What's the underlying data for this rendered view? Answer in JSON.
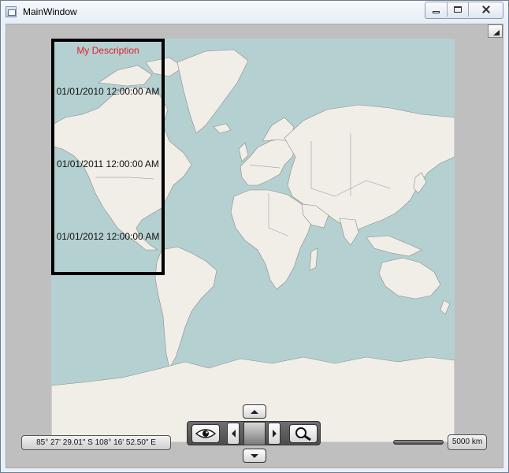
{
  "window": {
    "title": "MainWindow",
    "controls": [
      "minimize",
      "maximize",
      "close"
    ]
  },
  "map": {
    "description_title": "My Description",
    "dates": [
      "01/01/2010 12:00:00 AM",
      "01/01/2011 12:00:00 AM",
      "01/01/2012 12:00:00 AM"
    ],
    "coordinates": "85° 27' 29.01\" S 108° 16' 52.50\" E",
    "scale": "5000 km",
    "colors": {
      "water": "#b5d0d0",
      "land": "#f1eee8",
      "border": "#8c8c8c",
      "description_border": "#000000",
      "description_title": "#e0202a"
    }
  },
  "navigation": {
    "icons": [
      "eye-icon",
      "pan-up-icon",
      "pan-left-icon",
      "pan-right-icon",
      "pan-down-icon",
      "magnifier-icon"
    ]
  }
}
